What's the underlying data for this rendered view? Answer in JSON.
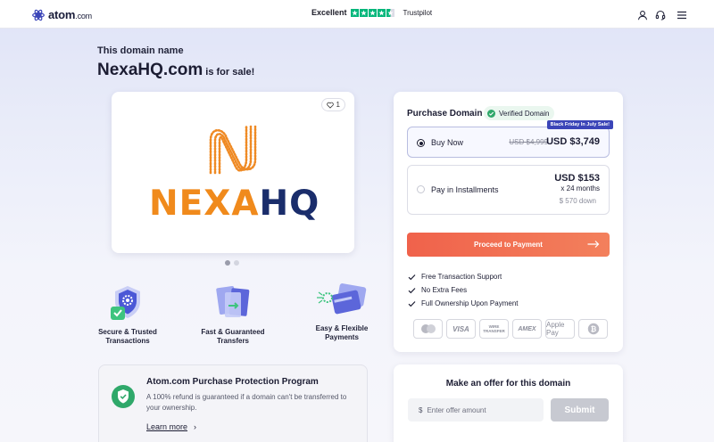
{
  "header": {
    "logo_text": "atom",
    "logo_suffix": ".com",
    "rating_label": "Excellent",
    "rating_stars": 4.5,
    "rating_brand": "Trustpilot",
    "icons": [
      "user-icon",
      "headset-icon",
      "menu-icon"
    ]
  },
  "listing": {
    "kicker": "This domain name",
    "domain": "NexaHQ.com",
    "sale_suffix": "is for sale!",
    "likes": "1",
    "brand_word_orange": "NEXA",
    "brand_word_blue": "HQ",
    "carousel_count": 2,
    "carousel_active": 1
  },
  "features": [
    {
      "label_line1": "Secure & Trusted",
      "label_line2": "Transactions",
      "icon": "shield-gear-icon"
    },
    {
      "label_line1": "Fast & Guaranteed",
      "label_line2": "Transfers",
      "icon": "transfer-cards-icon"
    },
    {
      "label_line1": "Easy & Flexible",
      "label_line2": "Payments",
      "icon": "payment-card-icon"
    }
  ],
  "protection": {
    "title": "Atom.com Purchase Protection Program",
    "description": "A 100% refund is guaranteed if a domain can't be transferred to your ownership.",
    "link": "Learn more"
  },
  "purchase": {
    "title": "Purchase Domain",
    "verified": "Verified Domain",
    "buy_now": {
      "label": "Buy Now",
      "ribbon": "Black Friday In July Sale!",
      "old_price": "USD $4,999",
      "price": "USD $3,749",
      "selected": true
    },
    "installments": {
      "label": "Pay in Installments",
      "price": "USD $153",
      "term": "x 24 months",
      "down": "$ 570 down",
      "selected": false
    },
    "proceed": "Proceed to Payment",
    "benefits": [
      "Free Transaction Support",
      "No Extra Fees",
      "Full Ownership Upon Payment"
    ],
    "payment_methods": [
      "mastercard",
      "VISA",
      "WIRE TRANSFER",
      "AMEX",
      "Apple Pay",
      "bitcoin"
    ]
  },
  "offer": {
    "title": "Make an offer for this domain",
    "currency": "$",
    "placeholder": "Enter offer amount",
    "submit": "Submit"
  },
  "colors": {
    "accent": "#f0624b",
    "brand_orange": "#f08a1c",
    "brand_navy": "#1a2d6b",
    "verified_green": "#2fa86a",
    "trustpilot_green": "#00b67a"
  }
}
